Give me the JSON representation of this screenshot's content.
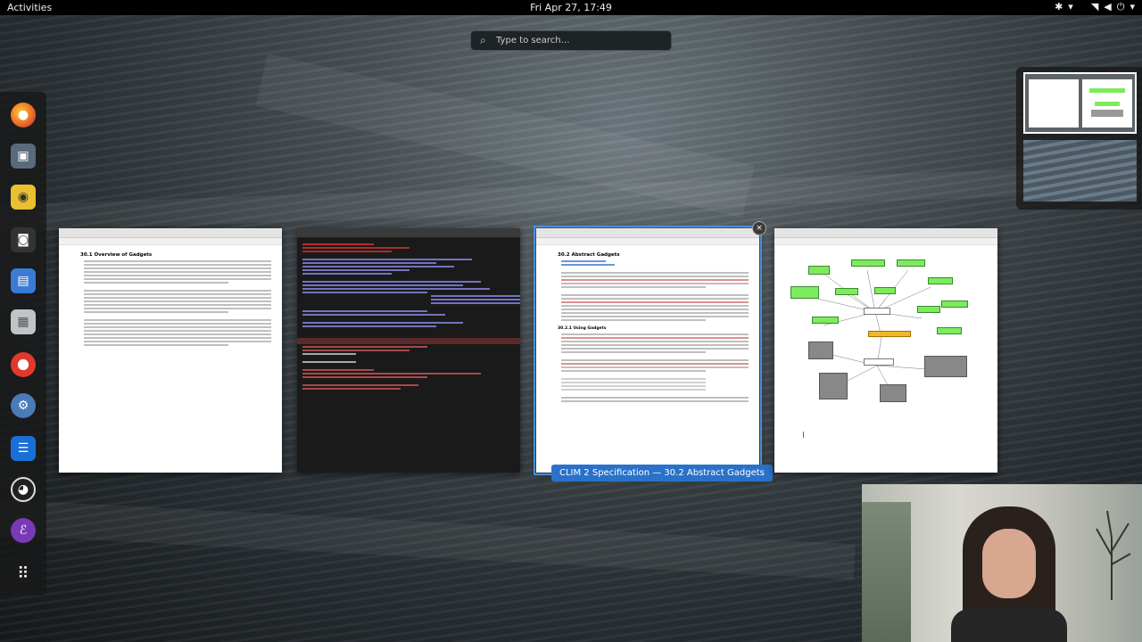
{
  "top_bar": {
    "activities": "Activities",
    "clock": "Fri Apr 27, 17:49",
    "tray_icons": [
      "accessibility-icon",
      "chevron-down-icon",
      "wifi-icon",
      "volume-icon",
      "power-icon",
      "chevron-down-icon"
    ]
  },
  "search": {
    "placeholder": "Type to search…"
  },
  "dash": {
    "apps": [
      {
        "name": "firefox-icon",
        "color": "#e8662a"
      },
      {
        "name": "screenshot-icon",
        "color": "#5a6a7a"
      },
      {
        "name": "rhythmbox-icon",
        "color": "#e8c030"
      },
      {
        "name": "camera-icon",
        "color": "#333333"
      },
      {
        "name": "documents-icon",
        "color": "#3a7bd5"
      },
      {
        "name": "archive-icon",
        "color": "#c0c4c8"
      },
      {
        "name": "help-icon",
        "color": "#e03a2a"
      },
      {
        "name": "settings-icon",
        "color": "#4a7ab8"
      },
      {
        "name": "list-app-icon",
        "color": "#1a6fd6"
      },
      {
        "name": "obs-icon",
        "color": "#202020"
      },
      {
        "name": "emacs-icon",
        "color": "#7a3ab8"
      }
    ],
    "show_apps": "show-applications-icon"
  },
  "windows": {
    "clim_overview": {
      "title": "30.1 Overview of Gadgets"
    },
    "terminal": {
      "title": "terminal"
    },
    "abstract_gadgets": {
      "title": "30.2 Abstract Gadgets",
      "subtitle": "30.2.1 Using Gadgets",
      "caption": "CLIM 2 Specification — 30.2 Abstract Gadgets",
      "close": "×"
    },
    "diagram": {
      "title": "diagram"
    }
  },
  "colors": {
    "accent": "#2a72c9",
    "highlight_node": "#7cec5e"
  }
}
